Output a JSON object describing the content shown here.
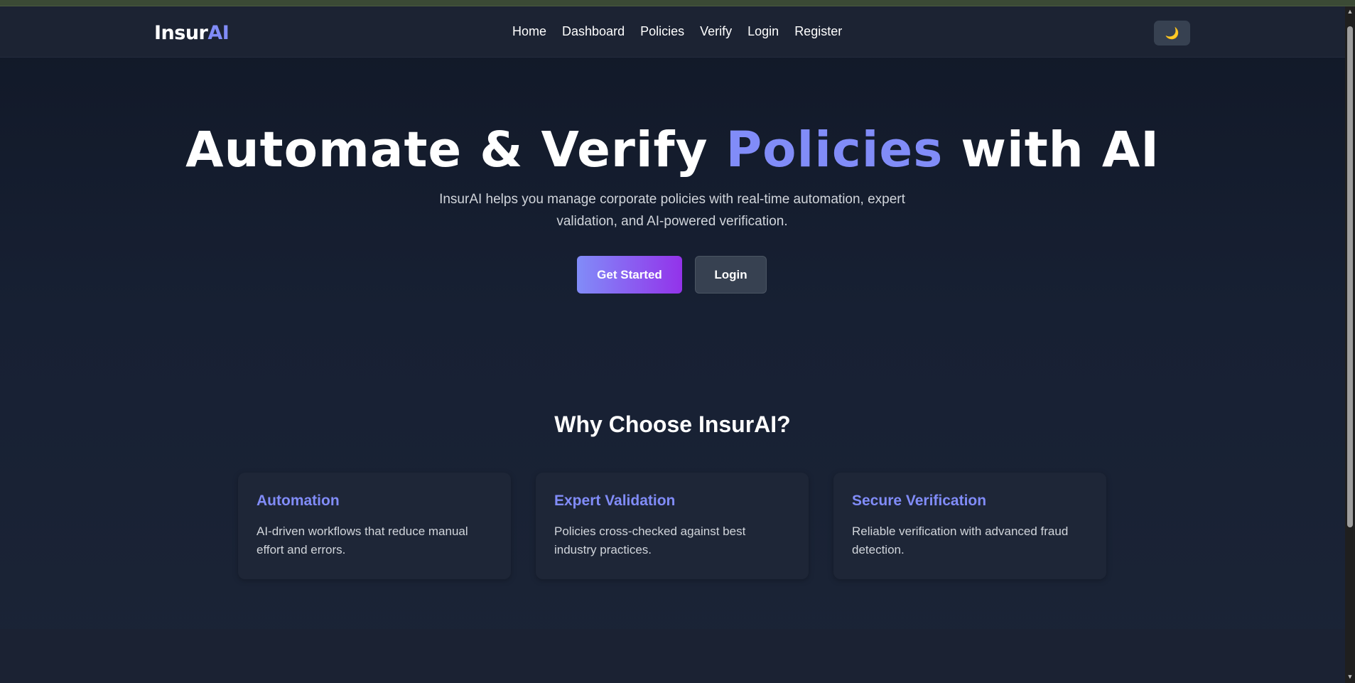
{
  "brand": {
    "part1": "Insur",
    "part2": "AI"
  },
  "nav": {
    "links": [
      "Home",
      "Dashboard",
      "Policies",
      "Verify",
      "Login",
      "Register"
    ],
    "theme_toggle_icon": "🌙"
  },
  "hero": {
    "title_pre": "Automate & Verify ",
    "title_highlight": "Policies",
    "title_post": " with AI",
    "subtitle": "InsurAI helps you manage corporate policies with real-time automation, expert validation, and AI-powered verification.",
    "primary_button": "Get Started",
    "secondary_button": "Login"
  },
  "features": {
    "title": "Why Choose InsurAI?",
    "cards": [
      {
        "title": "Automation",
        "text": "AI-driven workflows that reduce manual effort and errors."
      },
      {
        "title": "Expert Validation",
        "text": "Policies cross-checked against best industry practices."
      },
      {
        "title": "Secure Verification",
        "text": "Reliable verification with advanced fraud detection."
      }
    ]
  },
  "colors": {
    "accent": "#818cf8",
    "gradient_end": "#9333ea",
    "background": "#111827"
  }
}
